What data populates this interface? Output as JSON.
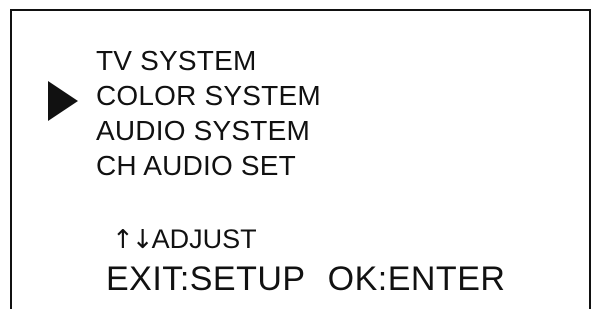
{
  "menu": {
    "items": [
      {
        "label": "TV SYSTEM"
      },
      {
        "label": "COLOR SYSTEM"
      },
      {
        "label": "AUDIO SYSTEM"
      },
      {
        "label": "CH AUDIO SET"
      }
    ],
    "selected_index": 1
  },
  "hints": {
    "adjust_arrows": "↑↓",
    "adjust_label": "ADJUST",
    "exit_key": "EXIT",
    "exit_action": ":SETUP",
    "ok_key": "OK",
    "ok_action": ":ENTER"
  },
  "colors": {
    "background": "#ffffff",
    "foreground": "#111111"
  },
  "icons": {
    "selector": "triangle-right-icon"
  }
}
